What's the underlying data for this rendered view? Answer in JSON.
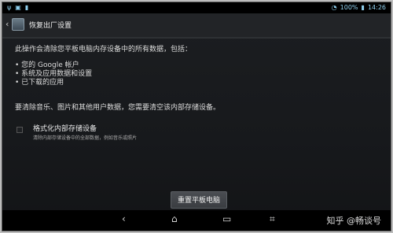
{
  "statusbar": {
    "left_icons": [
      "usb-icon",
      "image-icon",
      "notification-icon"
    ],
    "battery": "100%",
    "time": "14:26",
    "right_icons": [
      "wifi-icon",
      "battery-icon"
    ]
  },
  "actionbar": {
    "title": "恢复出厂设置"
  },
  "content": {
    "intro": "此操作会清除您平板电脑内存设备中的所有数据，包括：",
    "bullets": [
      "• 您的 Google 帐户",
      "• 系统及应用数据和设置",
      "• 已下载的应用"
    ],
    "note": "要清除音乐、图片和其他用户数据，您需要清空该内部存储设备。",
    "checkbox": {
      "label": "格式化内部存储设备",
      "sublabel": "清除内部存储设备中的全部数据，例如音乐或照片",
      "checked": false
    }
  },
  "reset_button": "重置平板电脑",
  "navbar": {
    "back": "back-icon",
    "home": "home-icon",
    "recent": "recent-apps-icon",
    "screenshot": "screenshot-icon"
  },
  "watermark": "知乎 @畅谈号",
  "colors": {
    "background": "#17191c",
    "statusbar_text": "#8fd0ef",
    "text": "#dcdcdc"
  }
}
